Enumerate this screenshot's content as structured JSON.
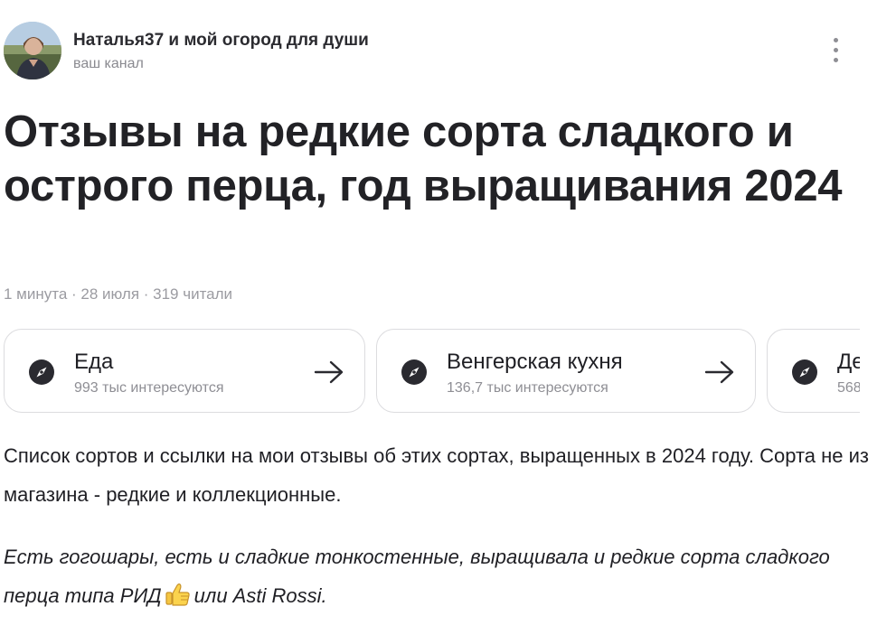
{
  "channel": {
    "name": "Наталья37 и мой огород для души",
    "subtitle": "ваш канал",
    "avatar_icon": "avatar-photo",
    "more_icon": "more-vertical-icon"
  },
  "article": {
    "title": "Отзывы на редкие сорта сладкого и острого перца, год выращивания 2024",
    "meta": "1 минута · 28 июля · 319 читали"
  },
  "chips": [
    {
      "title": "Еда",
      "count": "993 тыс интересуются",
      "icon": "compass-icon",
      "arrow": "arrow-right-icon"
    },
    {
      "title": "Венгерская кухня",
      "count": "136,7 тыс интересуются",
      "icon": "compass-icon",
      "arrow": "arrow-right-icon"
    },
    {
      "title": "Де",
      "count": "568",
      "icon": "compass-icon"
    }
  ],
  "body": {
    "paragraph1": "Список сортов и ссылки на мои отзывы об этих сортах, выращенных в 2024 году. Сорта не из магазина - редкие и коллекционные.",
    "paragraph2_before": "Есть гогошары, есть и сладкие тонкостенные, выращивала и редкие сорта сладкого перца типа РИД",
    "paragraph2_emoji": "thumbs-up-icon",
    "paragraph2_after": "или Asti Rossi."
  },
  "colors": {
    "text": "#1f1f24",
    "muted": "#8e8e94",
    "chip_border": "#dcdcdf",
    "icon_dark": "#2a2a30"
  }
}
